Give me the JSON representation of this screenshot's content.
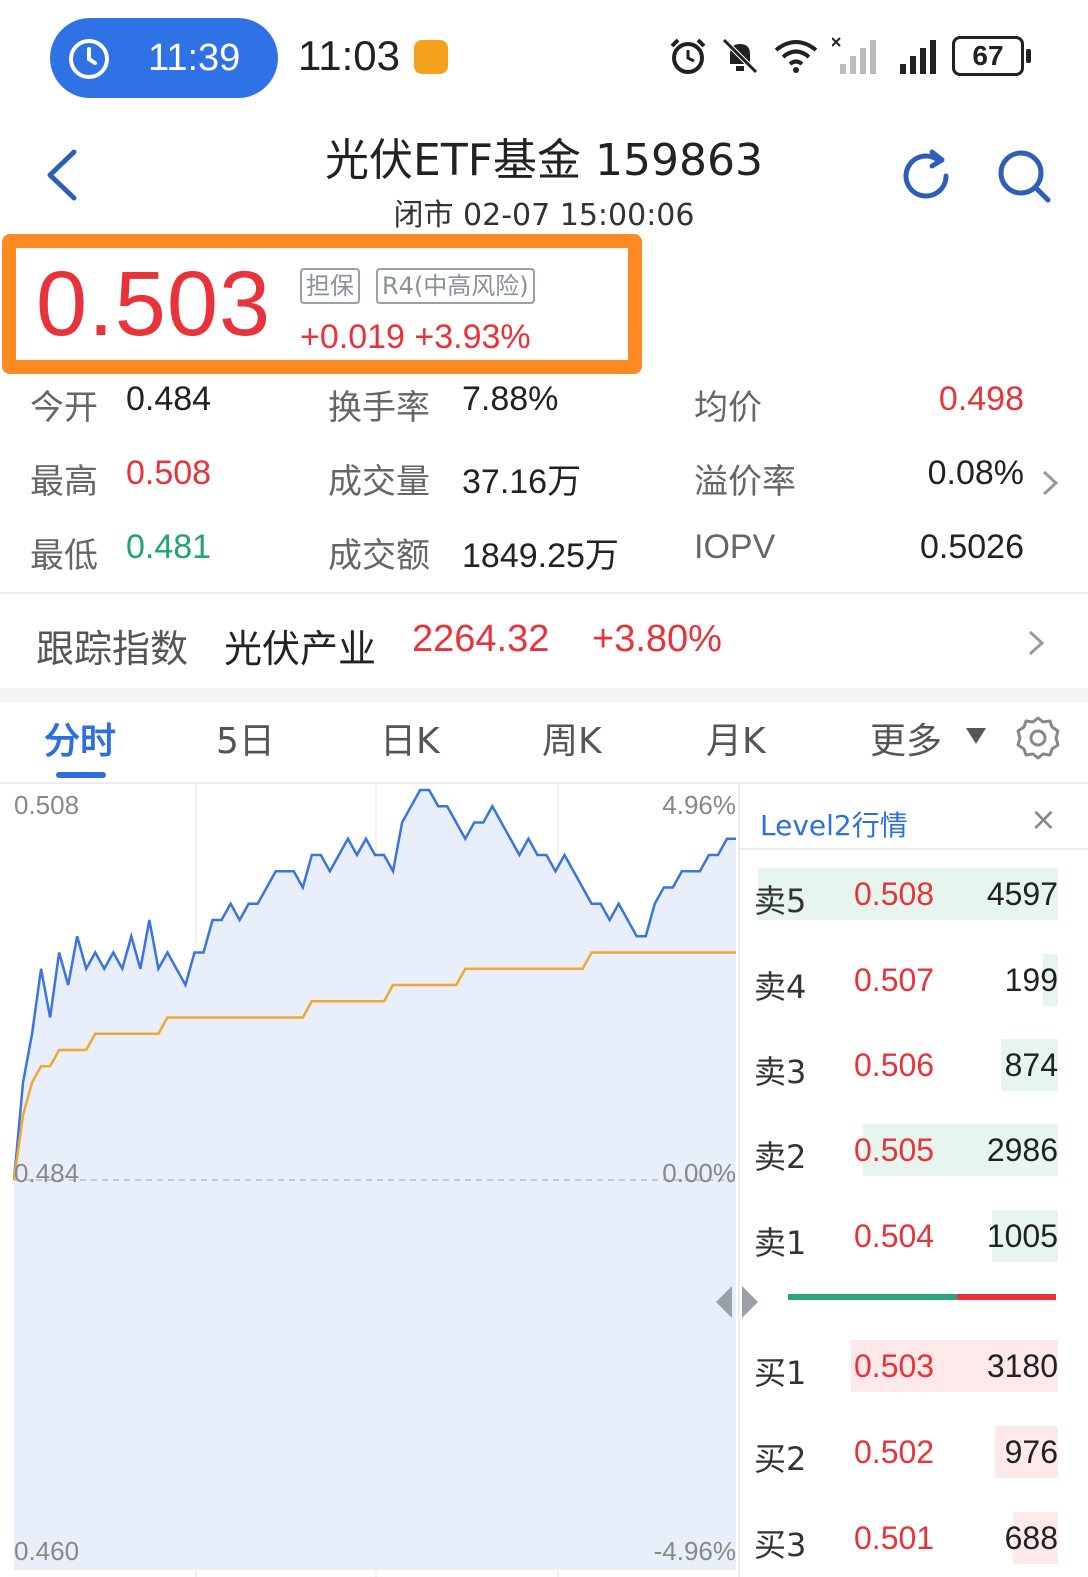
{
  "status_bar": {
    "pill_time": "11:39",
    "system_time": "11:03",
    "battery": "67",
    "icons": [
      "alarm-icon",
      "mute-icon",
      "wifi-icon",
      "signal-icon",
      "signal-4g-icon",
      "battery-icon"
    ],
    "pill_color": "#2e72e6"
  },
  "header": {
    "title": "光伏ETF基金 159863",
    "subtitle": "闭市 02-07 15:00:06"
  },
  "price": {
    "last": "0.503",
    "tag1": "担保",
    "tag2": "R4(中高风险)",
    "change": "+0.019",
    "change_pct": "+3.93%",
    "highlight_color": "#ff8a22"
  },
  "quote": {
    "open_label": "今开",
    "open_value": "0.484",
    "turnover_label": "换手率",
    "turnover_value": "7.88%",
    "avg_label": "均价",
    "avg_value": "0.498",
    "high_label": "最高",
    "high_value": "0.508",
    "volume_label": "成交量",
    "volume_value": "37.16万",
    "premium_label": "溢价率",
    "premium_value": "0.08%",
    "low_label": "最低",
    "low_value": "0.481",
    "amount_label": "成交额",
    "amount_value": "1849.25万",
    "iopv_label": "IOPV",
    "iopv_value": "0.5026"
  },
  "tracking": {
    "label": "跟踪指数",
    "name": "光伏产业",
    "value": "2264.32",
    "pct": "+3.80%"
  },
  "tabs": [
    {
      "label": "分时",
      "active": true
    },
    {
      "label": "5日",
      "active": false
    },
    {
      "label": "日K",
      "active": false
    },
    {
      "label": "周K",
      "active": false
    },
    {
      "label": "月K",
      "active": false
    },
    {
      "label": "更多",
      "active": false
    }
  ],
  "chart_data": {
    "type": "line",
    "y_axis_left": [
      "0.508",
      "0.484",
      "0.460"
    ],
    "y_axis_right": [
      "4.96%",
      "0.00%",
      "-4.96%"
    ],
    "ylim": [
      0.46,
      0.508
    ],
    "reference": 0.484,
    "colors": {
      "price": "#3b74e0",
      "avg": "#f0a830",
      "fill": "#e8eefa"
    },
    "series": [
      {
        "values": [
          0.484,
          0.49,
          0.493,
          0.497,
          0.494,
          0.498,
          0.496,
          0.499,
          0.497,
          0.498,
          0.497,
          0.498,
          0.497,
          0.499,
          0.497,
          0.5,
          0.497,
          0.498,
          0.497,
          0.496,
          0.498,
          0.498,
          0.5,
          0.5,
          0.501,
          0.5,
          0.501,
          0.501,
          0.502,
          0.503,
          0.503,
          0.503,
          0.502,
          0.504,
          0.504,
          0.503,
          0.504,
          0.505,
          0.504,
          0.505,
          0.504,
          0.504,
          0.503,
          0.506,
          0.507,
          0.508,
          0.508,
          0.507,
          0.507,
          0.506,
          0.505,
          0.506,
          0.506,
          0.507,
          0.506,
          0.505,
          0.504,
          0.505,
          0.504,
          0.504,
          0.503,
          0.504,
          0.503,
          0.502,
          0.501,
          0.501,
          0.5,
          0.501,
          0.5,
          0.499,
          0.499,
          0.501,
          0.502,
          0.502,
          0.503,
          0.503,
          0.503,
          0.504,
          0.504,
          0.505,
          0.505
        ]
      },
      {
        "values": [
          0.484,
          0.488,
          0.49,
          0.491,
          0.491,
          0.492,
          0.492,
          0.492,
          0.492,
          0.493,
          0.493,
          0.493,
          0.493,
          0.493,
          0.493,
          0.493,
          0.493,
          0.494,
          0.494,
          0.494,
          0.494,
          0.494,
          0.494,
          0.494,
          0.494,
          0.494,
          0.494,
          0.494,
          0.494,
          0.494,
          0.494,
          0.494,
          0.494,
          0.495,
          0.495,
          0.495,
          0.495,
          0.495,
          0.495,
          0.495,
          0.495,
          0.495,
          0.496,
          0.496,
          0.496,
          0.496,
          0.496,
          0.496,
          0.496,
          0.496,
          0.497,
          0.497,
          0.497,
          0.497,
          0.497,
          0.497,
          0.497,
          0.497,
          0.497,
          0.497,
          0.497,
          0.497,
          0.497,
          0.497,
          0.498,
          0.498,
          0.498,
          0.498,
          0.498,
          0.498,
          0.498,
          0.498,
          0.498,
          0.498,
          0.498,
          0.498,
          0.498,
          0.498,
          0.498,
          0.498,
          0.498
        ]
      }
    ]
  },
  "order_book": {
    "title": "Level2行情",
    "close": "×",
    "asks": [
      {
        "label": "卖5",
        "price": "0.508",
        "vol": "4597",
        "depth": 1.0
      },
      {
        "label": "卖4",
        "price": "0.507",
        "vol": "199",
        "depth": 0.05
      },
      {
        "label": "卖3",
        "price": "0.506",
        "vol": "874",
        "depth": 0.19
      },
      {
        "label": "卖2",
        "price": "0.505",
        "vol": "2986",
        "depth": 0.65
      },
      {
        "label": "卖1",
        "price": "0.504",
        "vol": "1005",
        "depth": 0.22
      }
    ],
    "bids": [
      {
        "label": "买1",
        "price": "0.503",
        "vol": "3180",
        "depth": 0.69
      },
      {
        "label": "买2",
        "price": "0.502",
        "vol": "976",
        "depth": 0.21
      },
      {
        "label": "买3",
        "price": "0.501",
        "vol": "688",
        "depth": 0.15
      }
    ],
    "buy_ratio": 0.63,
    "ask_color": "#e6f5ee",
    "bid_color": "#fde9ea"
  }
}
